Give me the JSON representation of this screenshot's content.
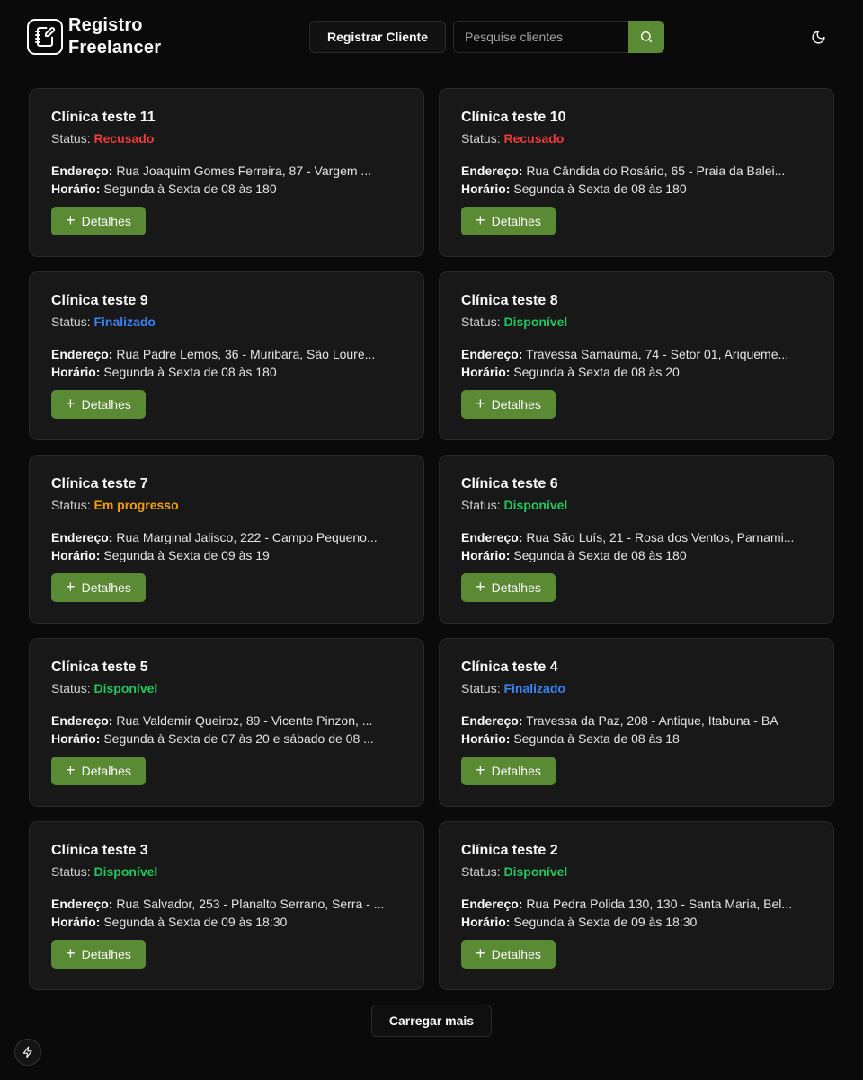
{
  "header": {
    "brand": "Registro Freelancer",
    "register_button": "Registrar Cliente",
    "search_placeholder": "Pesquise clientes",
    "search_icon": "search-icon",
    "theme_icon": "moon-icon",
    "logo_icon": "notebook-pen-icon"
  },
  "colors": {
    "accent": "#5b8a35",
    "status_refused": "#ef3b3b",
    "status_finished": "#3b82f6",
    "status_available": "#22c55e",
    "status_in_progress": "#f59e0b"
  },
  "labels": {
    "status": "Status:",
    "address": "Endereço:",
    "hours": "Horário:",
    "details": "Detalhes"
  },
  "cards": [
    {
      "title": "Clínica teste 11",
      "status": "Recusado",
      "status_kind": "refused",
      "address": "Rua Joaquim Gomes Ferreira, 87 - Vargem ...",
      "hours": "Segunda à Sexta de 08 às 180"
    },
    {
      "title": "Clínica teste 10",
      "status": "Recusado",
      "status_kind": "refused",
      "address": "Rua Cândida do Rosário, 65 - Praia da Balei...",
      "hours": "Segunda à Sexta de 08 às 180"
    },
    {
      "title": "Clínica teste 9",
      "status": "Finalizado",
      "status_kind": "finished",
      "address": "Rua Padre Lemos, 36 - Muribara, São Loure...",
      "hours": "Segunda à Sexta de 08 às 180"
    },
    {
      "title": "Clínica teste 8",
      "status": "Disponível",
      "status_kind": "available",
      "address": "Travessa Samaúma, 74 - Setor 01, Arique­me...",
      "hours": "Segunda à Sexta de 08 às 20"
    },
    {
      "title": "Clínica teste 7",
      "status": "Em progresso",
      "status_kind": "in_progress",
      "address": "Rua Marginal Jalisco, 222 - Campo Pequeno...",
      "hours": "Segunda à Sexta de 09 às 19"
    },
    {
      "title": "Clínica teste 6",
      "status": "Disponível",
      "status_kind": "available",
      "address": "Rua São Luís, 21 - Rosa dos Ventos, Parnami...",
      "hours": "Segunda à Sexta de 08 às 180"
    },
    {
      "title": "Clínica teste 5",
      "status": "Disponível",
      "status_kind": "available",
      "address": "Rua Valdemir Queiroz, 89 - Vicente Pinzon, ...",
      "hours": "Segunda à Sexta de 07 às 20 e sábado de 08 ..."
    },
    {
      "title": "Clínica teste 4",
      "status": "Finalizado",
      "status_kind": "finished",
      "address": "Travessa da Paz, 208 - Antique, Itabuna - BA",
      "hours": "Segunda à Sexta de 08 às 18"
    },
    {
      "title": "Clínica teste 3",
      "status": "Disponível",
      "status_kind": "available",
      "address": "Rua Salvador, 253 - Planalto Serrano, Serra - ...",
      "hours": "Segunda à Sexta de 09 às 18:30"
    },
    {
      "title": "Clínica teste 2",
      "status": "Disponível",
      "status_kind": "available",
      "address": "Rua Pedra Polida 130, 130 - Santa Maria, Bel...",
      "hours": "Segunda à Sexta de 09 às 18:30"
    }
  ],
  "load_more": "Carregar mais",
  "fab_icon": "lightning-icon"
}
